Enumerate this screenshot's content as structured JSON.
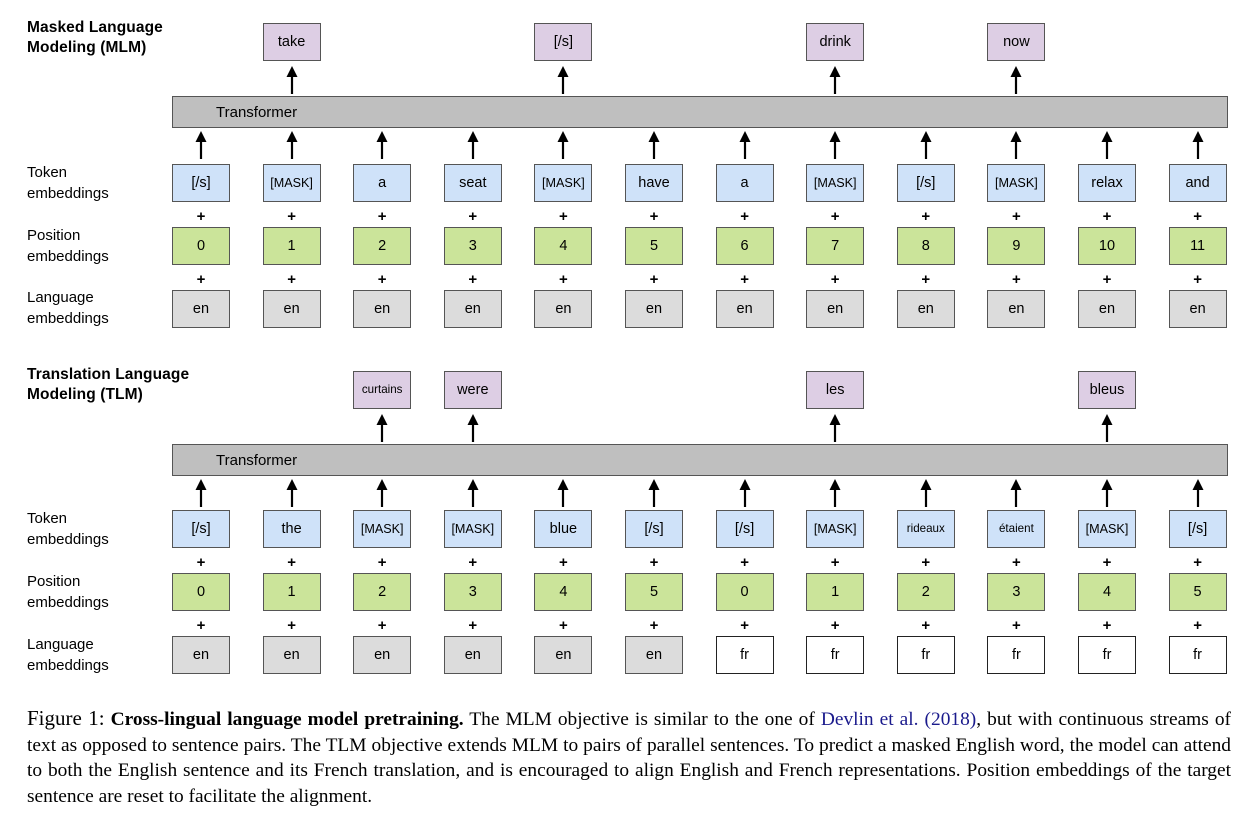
{
  "figure": {
    "label": "Figure 1:",
    "bold_title": "Cross-lingual language model pretraining.",
    "caption_rest": " The MLM objective is similar to the one of ",
    "citation": "Devlin et al. (2018)",
    "caption_tail": ", but with continuous streams of text as opposed to sentence pairs. The TLM objective extends MLM to pairs of parallel sentences. To predict a masked English word, the model can attend to both the English sentence and its French translation, and is encouraged to align English and French representations. Position embeddings of the target sentence are reset to facilitate the alignment."
  },
  "colors": {
    "output_box": "#ddcee4",
    "token_box": "#cfe2f9",
    "position_box": "#cbe49a",
    "language_box": "#dcdcdc",
    "language_box_fr": "#ffffff",
    "transformer_bar": "#bfbfbf",
    "border": "#555555",
    "citation_link": "#1a1a8c"
  },
  "row_labels": {
    "token": "Token\nembeddings",
    "position": "Position\nembeddings",
    "language": "Language\nembeddings"
  },
  "plus_symbol": "+",
  "transformer_label": "Transformer",
  "mlm": {
    "title": "Masked Language\nModeling (MLM)",
    "outputs": [
      {
        "col": 1,
        "text": "take"
      },
      {
        "col": 4,
        "text": "[/s]"
      },
      {
        "col": 7,
        "text": "drink"
      },
      {
        "col": 9,
        "text": "now"
      }
    ],
    "tokens": [
      "[/s]",
      "[MASK]",
      "a",
      "seat",
      "[MASK]",
      "have",
      "a",
      "[MASK]",
      "[/s]",
      "[MASK]",
      "relax",
      "and"
    ],
    "positions": [
      "0",
      "1",
      "2",
      "3",
      "4",
      "5",
      "6",
      "7",
      "8",
      "9",
      "10",
      "11"
    ],
    "languages": [
      "en",
      "en",
      "en",
      "en",
      "en",
      "en",
      "en",
      "en",
      "en",
      "en",
      "en",
      "en"
    ]
  },
  "tlm": {
    "title": "Translation Language\nModeling (TLM)",
    "outputs": [
      {
        "col": 2,
        "text": "curtains"
      },
      {
        "col": 3,
        "text": "were"
      },
      {
        "col": 7,
        "text": "les"
      },
      {
        "col": 10,
        "text": "bleus"
      }
    ],
    "tokens": [
      "[/s]",
      "the",
      "[MASK]",
      "[MASK]",
      "blue",
      "[/s]",
      "[/s]",
      "[MASK]",
      "rideaux",
      "étaient",
      "[MASK]",
      "[/s]"
    ],
    "positions": [
      "0",
      "1",
      "2",
      "3",
      "4",
      "5",
      "0",
      "1",
      "2",
      "3",
      "4",
      "5"
    ],
    "languages": [
      "en",
      "en",
      "en",
      "en",
      "en",
      "en",
      "fr",
      "fr",
      "fr",
      "fr",
      "fr",
      "fr"
    ]
  }
}
